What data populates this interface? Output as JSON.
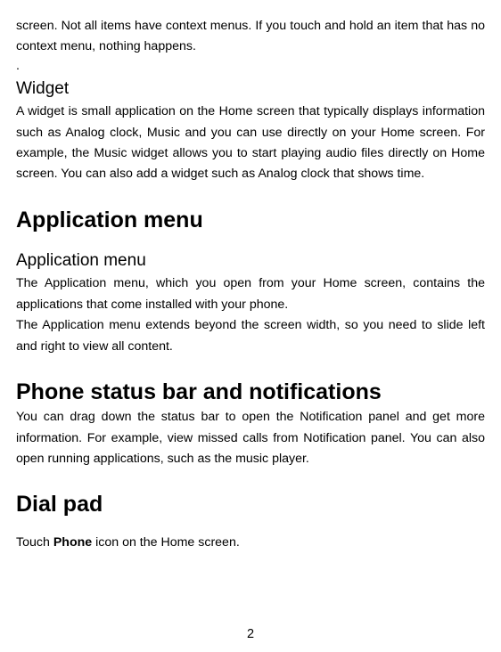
{
  "intro_para": "screen. Not all items have context menus. If you touch and hold an item that has no context menu, nothing happens.",
  "dot": ".",
  "widget_heading": "Widget",
  "widget_para": "A widget is small application on the Home screen that typically displays information such as Analog clock, Music and you can use directly on your Home screen. For example, the Music widget allows you to start playing audio files directly on Home screen. You can also add a widget such as Analog clock that shows time.",
  "appmenu_h1": "Application menu",
  "appmenu_h3": "Application menu",
  "appmenu_para1": "The Application menu, which you open from your Home screen, contains the applications that come installed with your phone.",
  "appmenu_para2": "The Application menu extends beyond the screen width, so you need to slide left and right to view all content.",
  "status_h1": "Phone status bar and notifications",
  "status_para": "You can drag down the status bar to open the Notification panel and get more information. For example, view missed calls from Notification panel. You can also open running applications, such as the music player.",
  "dial_h1": "Dial pad",
  "dial_pre": "Touch ",
  "dial_bold": "Phone",
  "dial_post": " icon on the Home screen.",
  "page_number": "2"
}
